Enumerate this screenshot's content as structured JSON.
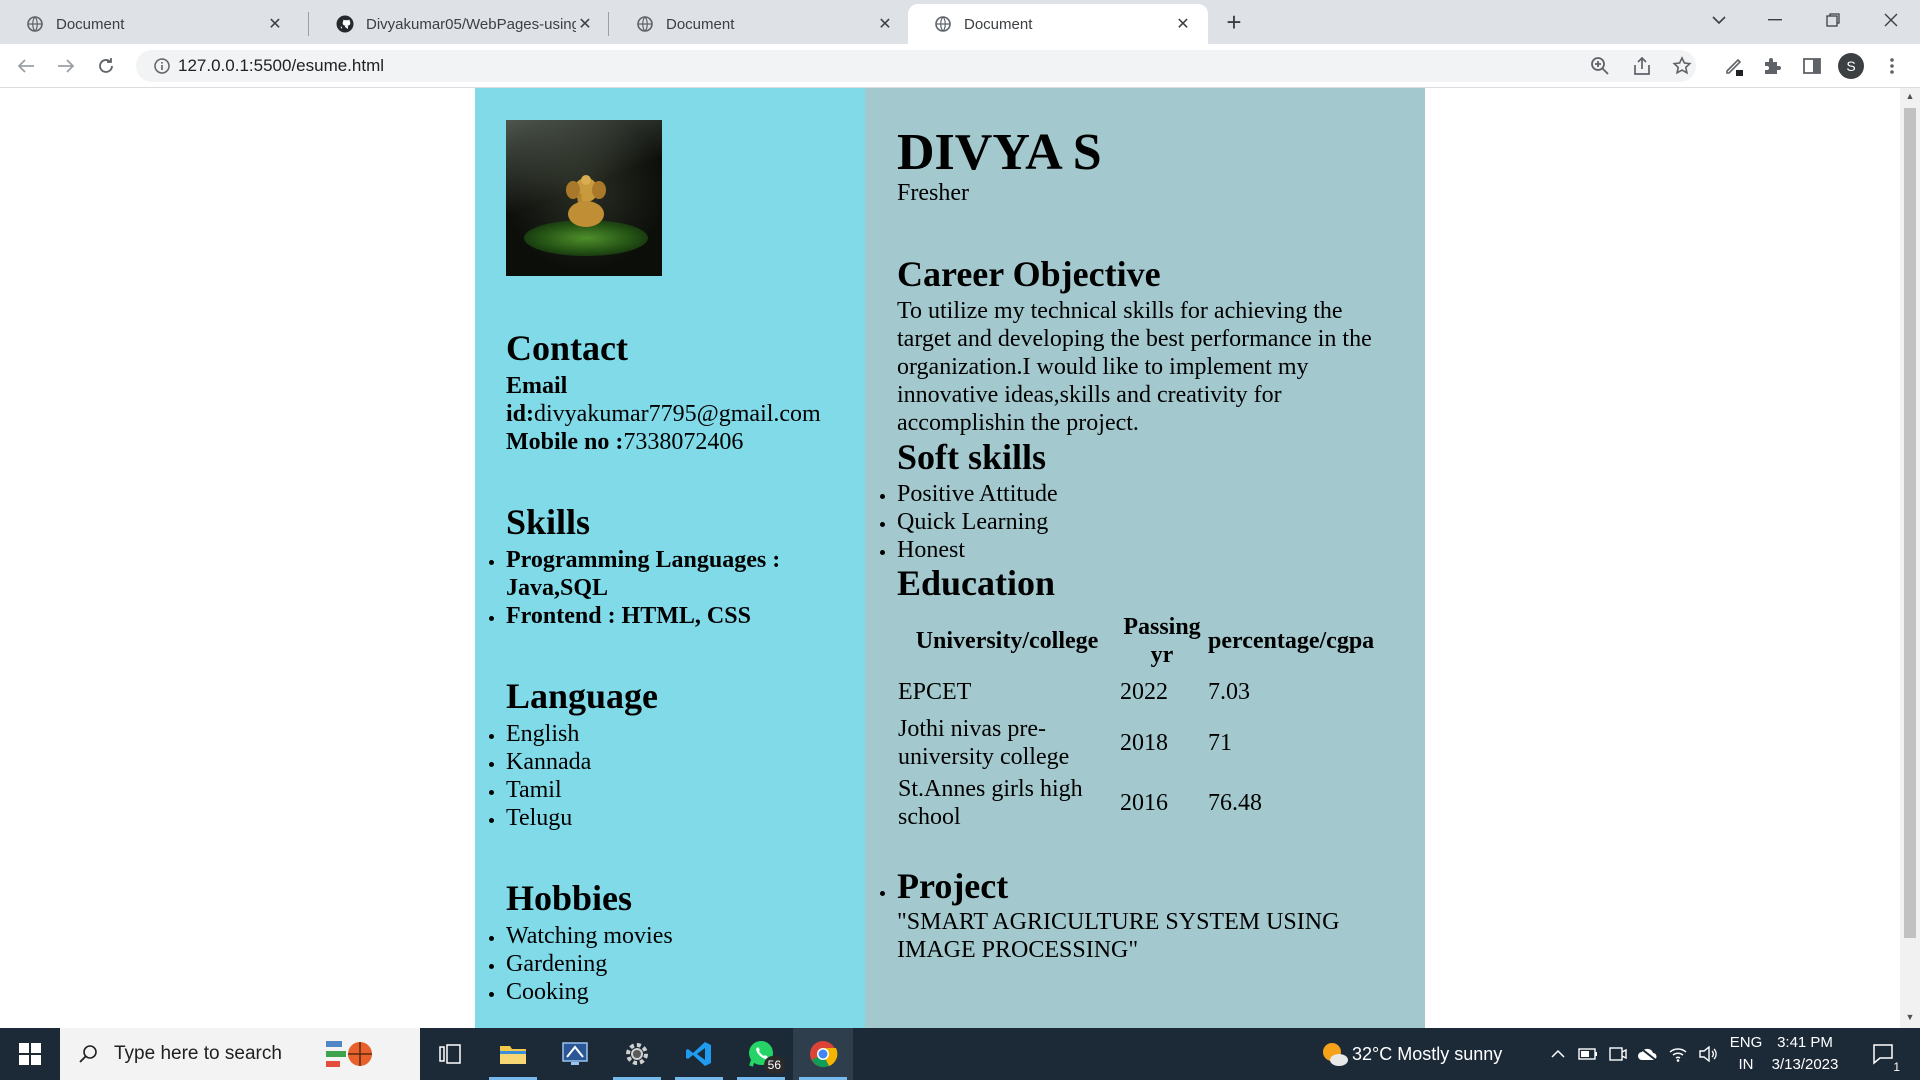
{
  "browser": {
    "tabs": [
      {
        "title": "Document",
        "icon": "globe-icon",
        "active": false
      },
      {
        "title": "Divyakumar05/WebPages-using-",
        "icon": "github-icon",
        "active": false
      },
      {
        "title": "Document",
        "icon": "globe-icon",
        "active": false
      },
      {
        "title": "Document",
        "icon": "globe-icon",
        "active": true
      }
    ],
    "url": "127.0.0.1:5500/esume.html",
    "profile_initial": "S"
  },
  "resume": {
    "name": "DIVYA S",
    "role": "Fresher",
    "contact": {
      "heading": "Contact",
      "email_label": "Email id:",
      "email_label_line1": "Email",
      "email_label_line2": "id:",
      "email_value": "divyakumar7795@gmail.com",
      "mobile_label": "Mobile no :",
      "mobile_value": "7338072406"
    },
    "skills": {
      "heading": "Skills",
      "items": [
        "Programming Languages :",
        "Java,SQL",
        "Frontend : HTML, CSS"
      ]
    },
    "language": {
      "heading": "Language",
      "items": [
        "English",
        "Kannada",
        "Tamil",
        "Telugu"
      ]
    },
    "hobbies": {
      "heading": "Hobbies",
      "items": [
        "Watching movies",
        "Gardening",
        "Cooking"
      ]
    },
    "career": {
      "heading": "Career Objective",
      "lines": [
        "To utilize my technical skills for achieving the",
        "target and developing the best performance in the",
        "organization.I would like to implement my",
        "innovative ideas,skills and creativity for",
        "accomplishin the project."
      ]
    },
    "soft_skills": {
      "heading": "Soft skills",
      "items": [
        "Positive Attitude",
        "Quick Learning",
        "Honest"
      ]
    },
    "education": {
      "heading": "Education",
      "columns": [
        "University/college",
        "Passing yr",
        "percentage/cgpa"
      ],
      "col2_line1": "Passing",
      "col2_line2": "yr",
      "rows": [
        {
          "college": "EPCET",
          "college_l1": "EPCET",
          "college_l2": "",
          "year": "2022",
          "score": "7.03"
        },
        {
          "college": "Jothi nivas pre-university college",
          "college_l1": "Jothi nivas pre-",
          "college_l2": "university college",
          "year": "2018",
          "score": "71"
        },
        {
          "college": "St.Annes girls high school",
          "college_l1": "St.Annes girls high",
          "college_l2": "school",
          "year": "2016",
          "score": "76.48"
        }
      ]
    },
    "project": {
      "heading": "Project",
      "line1": "\"SMART AGRICULTURE SYSTEM USING",
      "line2": "IMAGE PROCESSING\""
    }
  },
  "taskbar": {
    "search_placeholder": "Type here to search",
    "whatsapp_badge": "56",
    "weather": "32°C  Mostly sunny",
    "lang_line1": "ENG",
    "lang_line2": "IN",
    "time": "3:41 PM",
    "date": "3/13/2023",
    "notification_count": "1"
  },
  "colors": {
    "left_panel": "#80dae8",
    "right_panel": "#a3c9cf",
    "taskbar": "#1c2a38"
  }
}
